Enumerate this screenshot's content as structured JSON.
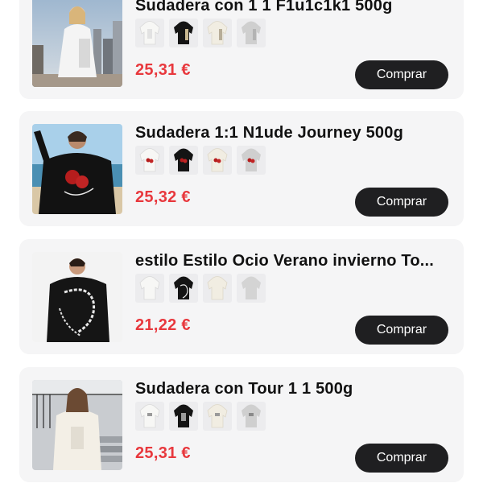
{
  "products": [
    {
      "title": "Sudadera con 1 1 F1u1c1k1 500g",
      "price": "25,31 €",
      "button": "Comprar",
      "photo_icon": "model-photo-icon",
      "hoodie_colors": [
        "#f4f4f2",
        "#141414",
        "#f0ece0",
        "#cfcfcf"
      ]
    },
    {
      "title": "Sudadera 1:1 N1ude Journey 500g",
      "price": "25,32 €",
      "button": "Comprar",
      "photo_icon": "model-photo-icon",
      "hoodie_colors": [
        "#f4f4f2",
        "#141414",
        "#f0ece0",
        "#cfcfcf"
      ]
    },
    {
      "title": "estilo Estilo Ocio Verano invierno To...",
      "price": "21,22 €",
      "button": "Comprar",
      "photo_icon": "model-photo-icon",
      "hoodie_colors": [
        "#f4f4f2",
        "#141414",
        "#f0ece0",
        "#d4d4d4"
      ]
    },
    {
      "title": "Sudadera con Tour 1 1 500g",
      "price": "25,31 €",
      "button": "Comprar",
      "photo_icon": "model-photo-icon",
      "hoodie_colors": [
        "#f4f4f2",
        "#141414",
        "#f0ece0",
        "#cfcfcf"
      ]
    }
  ]
}
